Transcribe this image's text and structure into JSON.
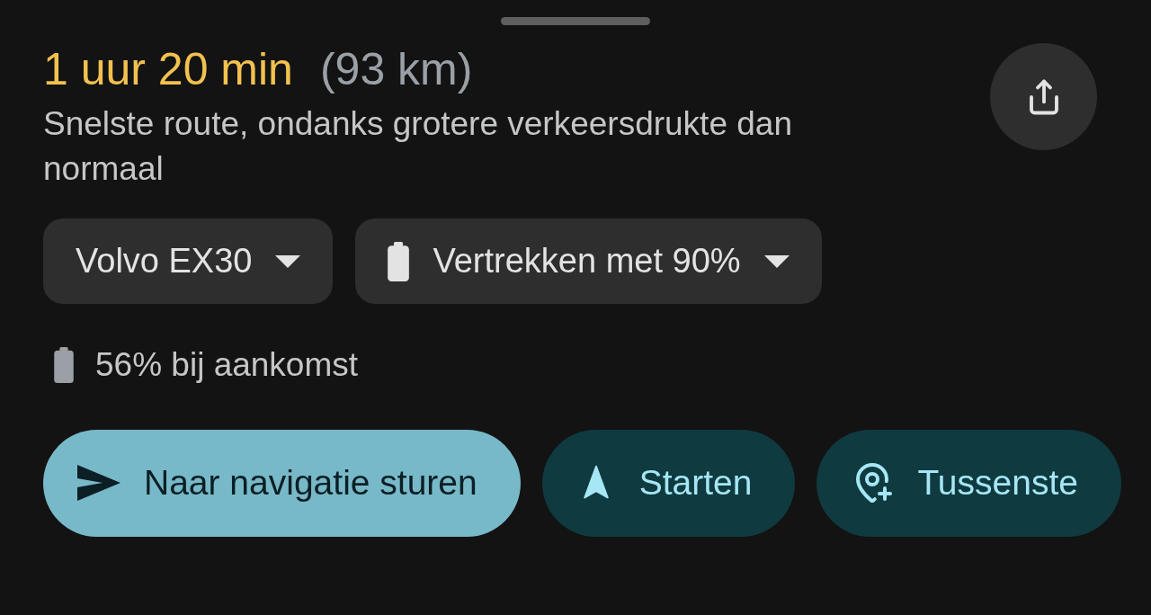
{
  "header": {
    "duration": "1 uur 20 min",
    "distance": "(93 km)"
  },
  "description": "Snelste route, ondanks grotere verkeersdrukte dan normaal",
  "chips": [
    {
      "kind": "plain",
      "label": "Volvo EX30"
    },
    {
      "kind": "battery",
      "label": "Vertrekken met 90%"
    }
  ],
  "arrival": "56% bij aankomst",
  "actions": [
    {
      "kind": "send",
      "label": "Naar navigatie sturen",
      "primary": true
    },
    {
      "kind": "start",
      "label": "Starten",
      "primary": false
    },
    {
      "kind": "stop",
      "label": "Tussenste",
      "primary": false
    }
  ]
}
